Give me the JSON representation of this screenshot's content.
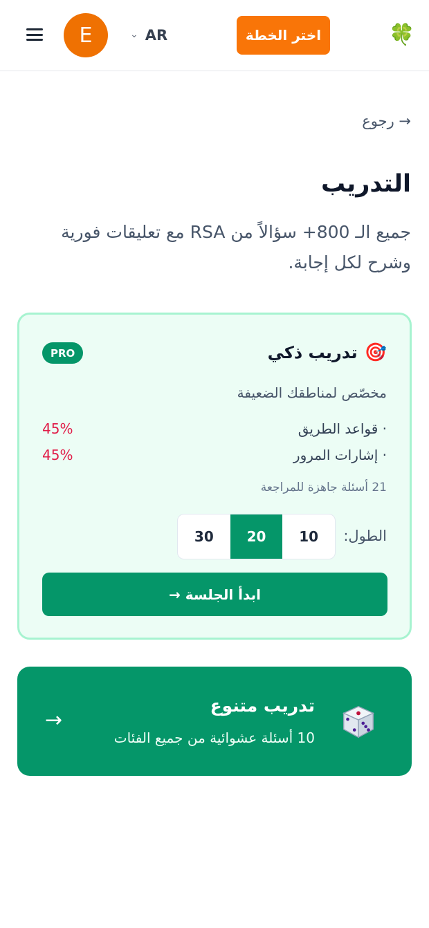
{
  "header": {
    "menu_icon": "hamburger-menu-icon",
    "avatar_initial": "E",
    "language": {
      "chevron_icon": "chevron-down-icon",
      "code": "AR"
    },
    "plan_button": "اختر الخطة",
    "logo_icon": "🍀"
  },
  "page": {
    "back_link": "→ رجوع",
    "title": "التدريب",
    "subtitle": "جميع الـ 800+ سؤالاً من RSA مع تعليقات فورية وشرح لكل إجابة."
  },
  "smart_practice": {
    "icon": "🎯",
    "title": "تدريب ذكي",
    "badge": "PRO",
    "tailored_text": "مخصّص لمناطقك الضعيفة",
    "weak_areas": [
      {
        "name": "· قواعد الطريق",
        "percent": "45%"
      },
      {
        "name": "· إشارات المرور",
        "percent": "45%"
      }
    ],
    "ready_text": "21 أسئلة جاهزة للمراجعة",
    "length_label": "الطول:",
    "length_options": [
      "30",
      "20",
      "10"
    ],
    "selected_length": "20",
    "start_button": "ابدأ الجلسة →"
  },
  "mixed_practice": {
    "icon": "dice-icon",
    "title": "تدريب متنوع",
    "subtitle": "10 أسئلة عشوائية من جميع الفئات",
    "arrow": "→"
  },
  "colors": {
    "brand_green": "#059669",
    "accent_orange": "#f97508",
    "avatar_orange": "#ef7102",
    "danger": "#e11d48"
  }
}
